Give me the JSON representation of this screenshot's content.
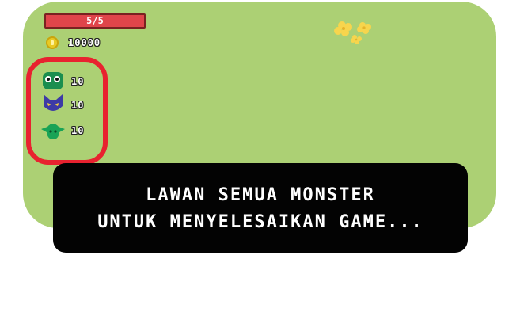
{
  "hud": {
    "health_text": "5/5",
    "health_fraction": 1.0,
    "coins": "10000"
  },
  "monsters": [
    {
      "icon": "green-blob-monster-icon",
      "count": "10"
    },
    {
      "icon": "purple-cat-monster-icon",
      "count": "10"
    },
    {
      "icon": "green-goblin-monster-icon",
      "count": "10"
    }
  ],
  "dialog": {
    "line1": "LAWAN SEMUA MONSTER",
    "line2": "UNTUK MENYELESAIKAN GAME..."
  },
  "colors": {
    "playfield": "#acd074",
    "health": "#e0454a",
    "panel_border": "#e8222f",
    "dialog_bg": "#030303"
  }
}
